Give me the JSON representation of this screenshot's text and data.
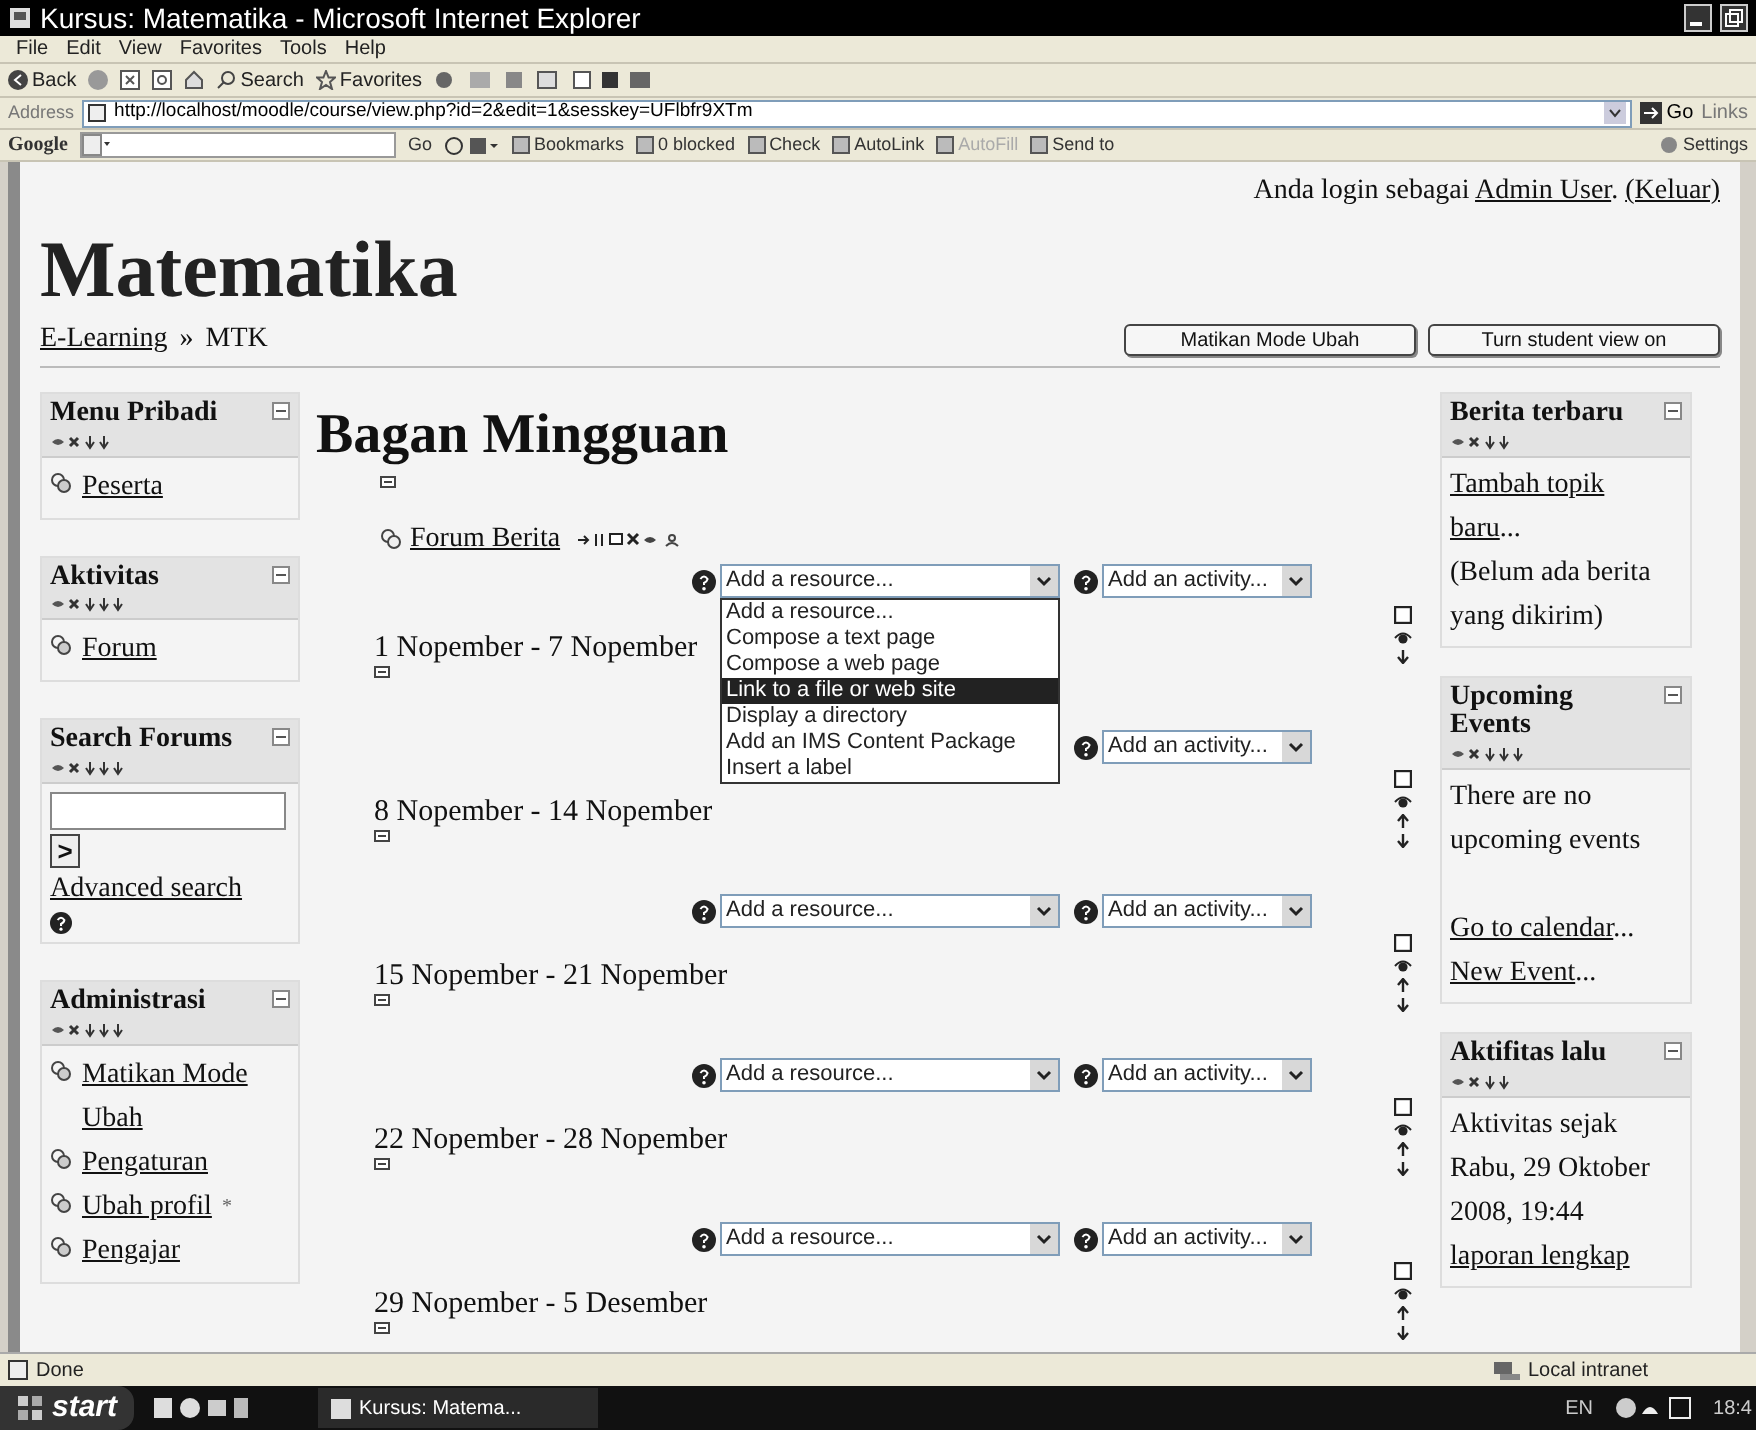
{
  "window": {
    "title": "Kursus: Matematika - Microsoft Internet Explorer"
  },
  "menu": [
    "File",
    "Edit",
    "View",
    "Favorites",
    "Tools",
    "Help"
  ],
  "toolbar": {
    "back": "Back",
    "search": "Search",
    "favorites": "Favorites"
  },
  "address": {
    "label": "Address",
    "url": "http://localhost/moodle/course/view.php?id=2&edit=1&sesskey=UFlbfr9XTm",
    "go": "Go",
    "links": "Links"
  },
  "google_bar": {
    "label": "Google",
    "go": "Go",
    "items": [
      "Bookmarks",
      "0 blocked",
      "Check",
      "AutoLink",
      "AutoFill",
      "Send to"
    ],
    "settings": "Settings"
  },
  "page": {
    "site_title": "Matematika",
    "login": {
      "prefix": "Anda login sebagai",
      "user": "Admin User",
      "suffix": ".",
      "logout": "(Keluar)"
    },
    "breadcrumb": [
      "E-Learning",
      "MTK"
    ],
    "separator": "»",
    "buttons": [
      "Matikan Mode Ubah",
      "Turn student view on"
    ],
    "left_blocks": [
      {
        "kind": "links",
        "title": "Menu Pribadi",
        "items": [
          {
            "text": "Peserta"
          }
        ]
      },
      {
        "kind": "links",
        "title": "Aktivitas",
        "items": [
          {
            "text": "Forum"
          }
        ]
      },
      {
        "kind": "search",
        "title": "Search Forums",
        "button": ">",
        "link": "Advanced search"
      },
      {
        "kind": "links",
        "title": "Administrasi",
        "items": [
          {
            "text": "Matikan Mode Ubah"
          },
          {
            "text": "Pengaturan"
          },
          {
            "text": "Ubah profil",
            "mark": "*"
          },
          {
            "text": "Pengajar"
          }
        ]
      }
    ],
    "heading": "Bagan Mingguan",
    "section_zero": {
      "forum": "Forum Berita",
      "resource": "Add a resource...",
      "activity": "Add an activity...",
      "dropdown": [
        {
          "text": "Add a resource...",
          "selected": false
        },
        {
          "text": "Compose a text page",
          "selected": false
        },
        {
          "text": "Compose a web page",
          "selected": false
        },
        {
          "text": "Link to a file or web site",
          "selected": true
        },
        {
          "text": "Display a directory",
          "selected": false
        },
        {
          "text": "Add an IMS Content Package",
          "selected": false
        },
        {
          "text": "Insert a label",
          "selected": false
        }
      ]
    },
    "weeks": [
      {
        "title": "1 Nopember - 7 Nopember",
        "activity": "Add an activity..."
      },
      {
        "title": "8 Nopember - 14 Nopember",
        "resource": "Add a resource...",
        "activity": "Add an activity..."
      },
      {
        "title": "15 Nopember - 21 Nopember",
        "resource": "Add a resource...",
        "activity": "Add an activity..."
      },
      {
        "title": "22 Nopember - 28 Nopember",
        "resource": "Add a resource...",
        "activity": "Add an activity..."
      },
      {
        "title": "29 Nopember - 5 Desember"
      }
    ],
    "right_blocks": [
      {
        "title": "Berita terbaru",
        "lines": [
          {
            "kind": "link",
            "text": "Tambah topik baru",
            "suffix": "..."
          },
          {
            "kind": "text",
            "text": "(Belum ada berita yang dikirim)"
          }
        ]
      },
      {
        "title": "Upcoming Events",
        "lines": [
          {
            "kind": "text",
            "text": "There are no upcoming events"
          },
          {
            "kind": "gap"
          },
          {
            "kind": "link",
            "text": "Go to calendar",
            "suffix": "..."
          },
          {
            "kind": "link",
            "text": "New Event",
            "suffix": "..."
          }
        ]
      },
      {
        "title": "Aktifitas lalu",
        "lines": [
          {
            "kind": "text",
            "text": "Aktivitas sejak Rabu, 29 Oktober 2008, 19:44"
          },
          {
            "kind": "link",
            "text": "laporan lengkap"
          }
        ]
      }
    ]
  },
  "status_bar": {
    "text": "Done",
    "zone": "Local intranet"
  },
  "taskbar": {
    "start": "start",
    "task": "Kursus: Matema...",
    "language": "EN",
    "clock": "18:4"
  }
}
